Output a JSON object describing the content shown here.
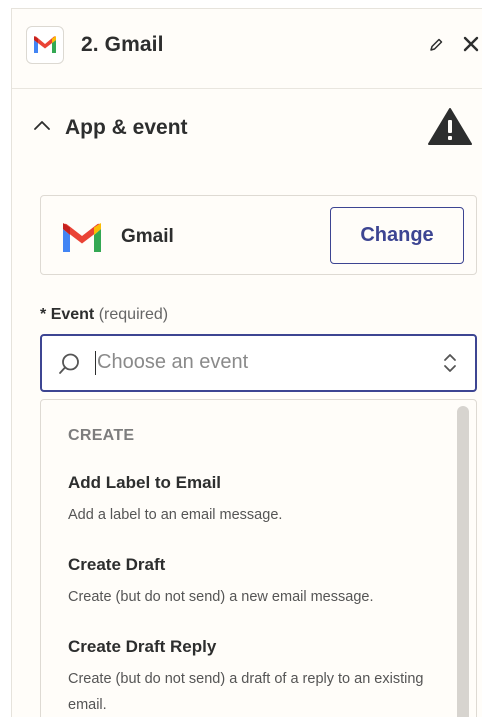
{
  "header": {
    "app_icon": "gmail-logo",
    "title": "2. Gmail",
    "edit_icon": "pencil-icon",
    "close_icon": "close-icon"
  },
  "section": {
    "title": "App & event",
    "collapse_icon": "chevron-up-icon",
    "status_icon": "warning-icon"
  },
  "app_card": {
    "app_icon": "gmail-logo",
    "app_name": "Gmail",
    "change_label": "Change"
  },
  "event_field": {
    "required_marker": "*",
    "label": "Event",
    "required_note": "(required)",
    "placeholder": "Choose an event"
  },
  "dropdown": {
    "group_label": "CREATE",
    "options": [
      {
        "title": "Add Label to Email",
        "description": "Add a label to an email message."
      },
      {
        "title": "Create Draft",
        "description": "Create (but do not send) a new email message."
      },
      {
        "title": "Create Draft Reply",
        "description": "Create (but do not send) a draft of a reply to an existing email."
      }
    ]
  },
  "colors": {
    "accent": "#3d4592",
    "panel_bg": "#fffdf9",
    "warning": "#2d2e2e",
    "gmail_red": "#ea4335",
    "gmail_blue": "#4285f4",
    "gmail_green": "#34a853",
    "gmail_yellow": "#fbbc04"
  }
}
